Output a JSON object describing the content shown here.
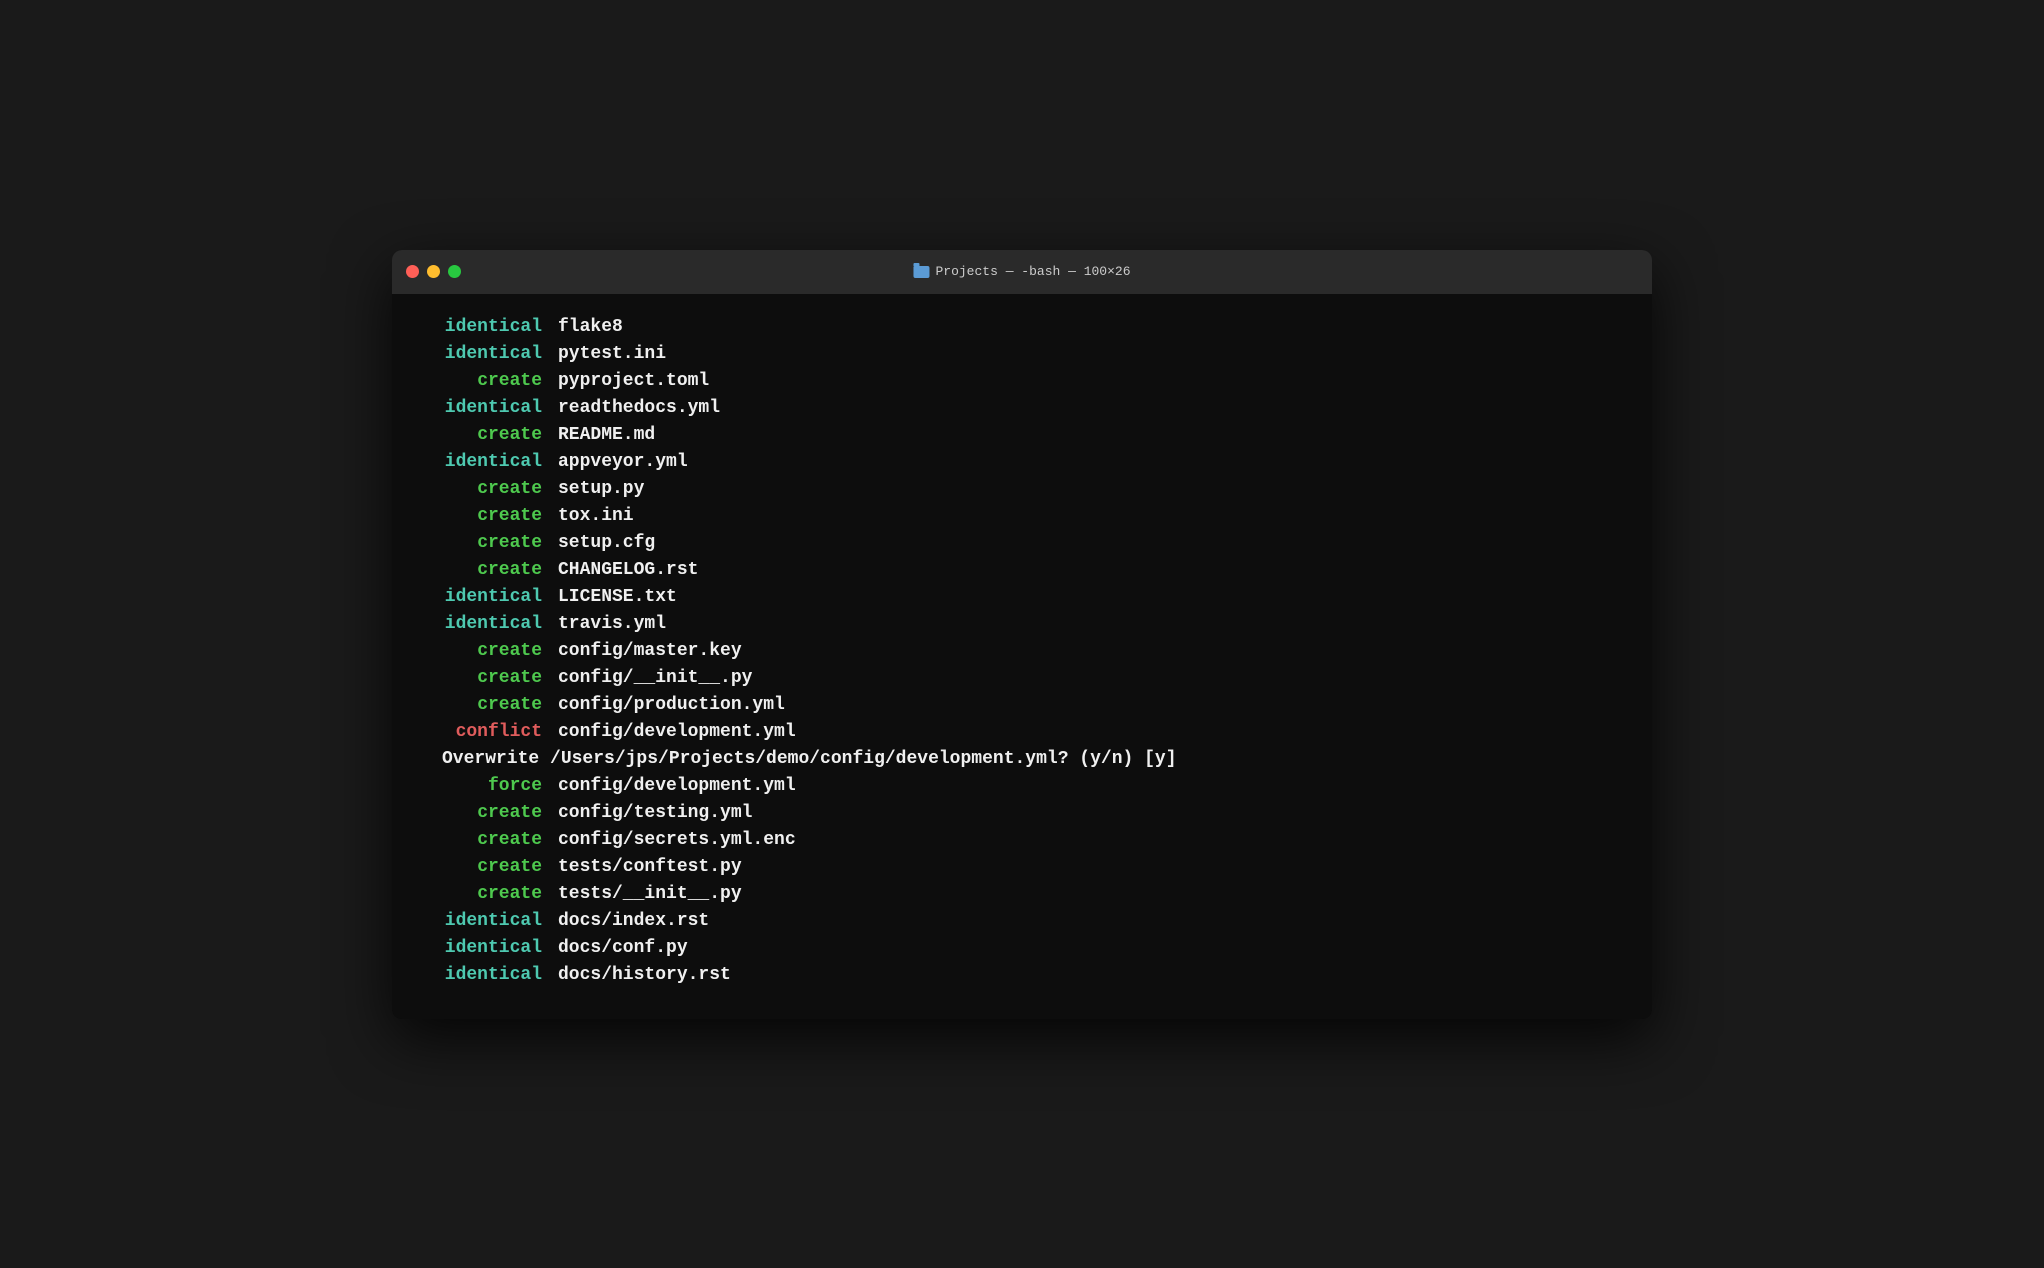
{
  "window": {
    "title": "Projects — -bash — 100×26",
    "traffic_lights": {
      "close_label": "close",
      "minimize_label": "minimize",
      "maximize_label": "maximize"
    }
  },
  "terminal": {
    "lines": [
      {
        "status": "identical",
        "status_type": "identical",
        "file": "flake8"
      },
      {
        "status": "identical",
        "status_type": "identical",
        "file": "pytest.ini"
      },
      {
        "status": "create",
        "status_type": "create",
        "file": "pyproject.toml"
      },
      {
        "status": "identical",
        "status_type": "identical",
        "file": "readthedocs.yml"
      },
      {
        "status": "create",
        "status_type": "create",
        "file": "README.md"
      },
      {
        "status": "identical",
        "status_type": "identical",
        "file": "appveyor.yml"
      },
      {
        "status": "create",
        "status_type": "create",
        "file": "setup.py"
      },
      {
        "status": "create",
        "status_type": "create",
        "file": "tox.ini"
      },
      {
        "status": "create",
        "status_type": "create",
        "file": "setup.cfg"
      },
      {
        "status": "create",
        "status_type": "create",
        "file": "CHANGELOG.rst"
      },
      {
        "status": "identical",
        "status_type": "identical",
        "file": "LICENSE.txt"
      },
      {
        "status": "identical",
        "status_type": "identical",
        "file": "travis.yml"
      },
      {
        "status": "create",
        "status_type": "create",
        "file": "config/master.key"
      },
      {
        "status": "create",
        "status_type": "create",
        "file": "config/__init__.py"
      },
      {
        "status": "create",
        "status_type": "create",
        "file": "config/production.yml"
      },
      {
        "status": "conflict",
        "status_type": "conflict",
        "file": "config/development.yml"
      }
    ],
    "overwrite_prompt": "Overwrite /Users/jps/Projects/demo/config/development.yml? (y/n) [y]",
    "lines2": [
      {
        "status": "force",
        "status_type": "force",
        "file": "config/development.yml"
      },
      {
        "status": "create",
        "status_type": "create",
        "file": "config/testing.yml"
      },
      {
        "status": "create",
        "status_type": "create",
        "file": "config/secrets.yml.enc"
      },
      {
        "status": "create",
        "status_type": "create",
        "file": "tests/conftest.py"
      },
      {
        "status": "create",
        "status_type": "create",
        "file": "tests/__init__.py"
      },
      {
        "status": "identical",
        "status_type": "identical",
        "file": "docs/index.rst"
      },
      {
        "status": "identical",
        "status_type": "identical",
        "file": "docs/conf.py"
      },
      {
        "status": "identical",
        "status_type": "identical",
        "file": "docs/history.rst"
      }
    ]
  }
}
